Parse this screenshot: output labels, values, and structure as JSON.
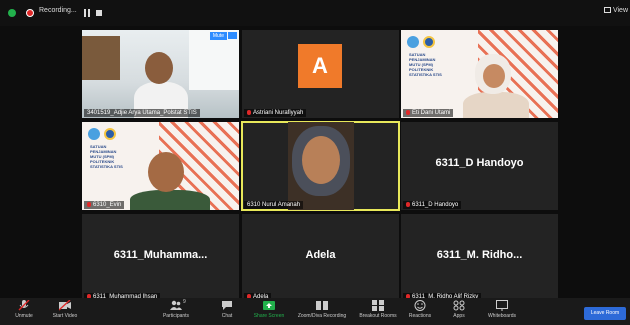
{
  "topbar": {
    "recording_label": "Recording...",
    "view_label": "View"
  },
  "tiles": [
    {
      "name": "3401519_Adjie Arya Utama_Polstat STIS",
      "badge": "Mute"
    },
    {
      "name": "Astriani Nurafiyyah",
      "avatar_letter": "A",
      "avatar_color": "#f07a2a"
    },
    {
      "name": "Eti Dani Utami"
    },
    {
      "name": "6310_Evin"
    },
    {
      "name": "6310 Nurul Amanah"
    },
    {
      "name": "6311_D Handoyo",
      "big": "6311_D Handoyo"
    },
    {
      "name": "6311_Muhammad Ihsan",
      "big": "6311_Muhamma..."
    },
    {
      "name": "Adela",
      "big": "Adela"
    },
    {
      "name": "6311_M. Ridho Alif Rizky",
      "big": "6311_M. Ridho..."
    }
  ],
  "banner": {
    "text": "SATUAN\nPENJAMINAN\nMUTU (SPM)\nPOLITEKNIK\nSTATISTIKA STIS"
  },
  "toolbar": {
    "unmute": "Unmute",
    "stop_video": "Start Video",
    "participants": "Participants",
    "participants_count": "9",
    "chat": "Chat",
    "share_screen": "Share Screen",
    "zoom_apps": "Zoom/Diva Recording",
    "breakout": "Breakout Rooms",
    "reactions": "Reactions",
    "apps": "Apps",
    "whiteboards": "Whiteboards",
    "leave": "Leave Room"
  },
  "colors": {
    "accent": "#2d8cff",
    "share_green": "#22b14c",
    "leave_blue": "#2d6ad8",
    "highlight": "#e8e85a",
    "muted_red": "#e02828"
  }
}
